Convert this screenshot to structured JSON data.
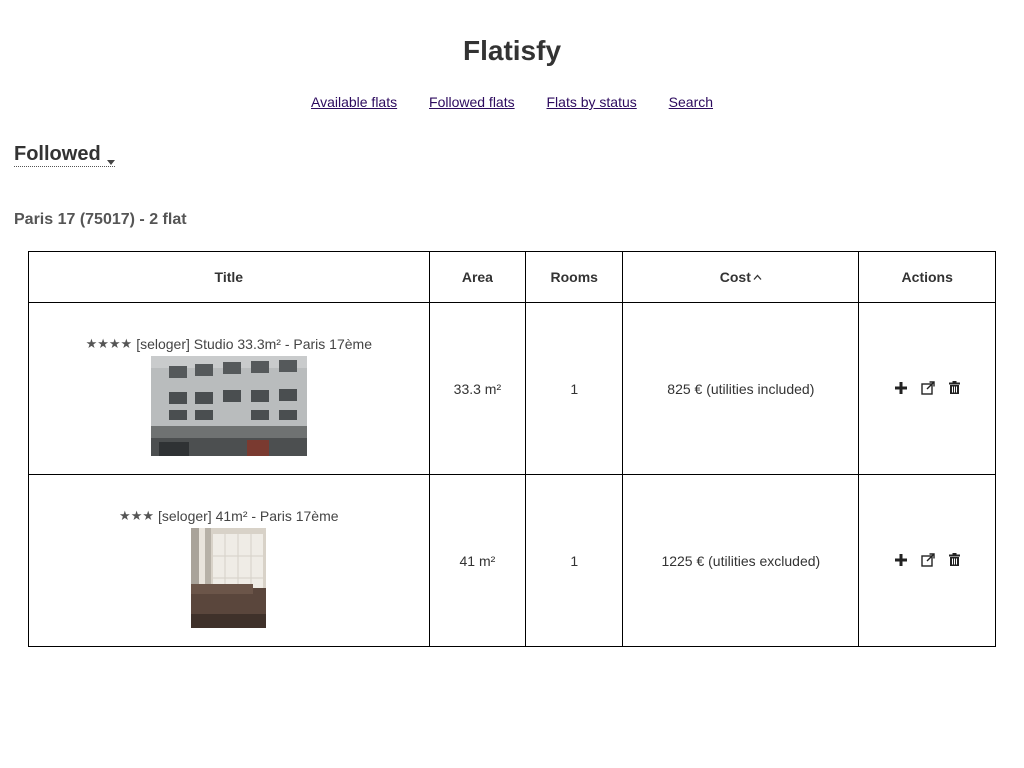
{
  "app": {
    "title": "Flatisfy"
  },
  "nav": {
    "items": [
      "Available flats",
      "Followed flats",
      "Flats by status",
      "Search"
    ]
  },
  "status_select": {
    "selected": "Followed"
  },
  "group": {
    "heading": "Paris 17 (75017) - 2 flat"
  },
  "table": {
    "headers": {
      "title": "Title",
      "area": "Area",
      "rooms": "Rooms",
      "cost": "Cost",
      "actions": "Actions"
    },
    "sort": {
      "column": "cost",
      "direction": "ascending",
      "indicator_icon": "chevron-up-icon"
    },
    "rows": [
      {
        "stars": 4,
        "title": "[seloger] Studio 33.3m² - Paris 17ème",
        "photo_icon": "building-facade-photo",
        "area": "33.3 m²",
        "rooms": "1",
        "cost": "825 € (utilities included)"
      },
      {
        "stars": 3,
        "title": "[seloger] 41m² - Paris 17ème",
        "photo_icon": "living-room-photo",
        "area": "41 m²",
        "rooms": "1",
        "cost": "1225 € (utilities excluded)"
      }
    ],
    "action_icons": [
      "plus-icon",
      "external-link-icon",
      "trash-icon"
    ]
  },
  "colors": {
    "text": "#333333",
    "link": "#2c0a5e",
    "border": "#000000",
    "stars": "#555555"
  }
}
